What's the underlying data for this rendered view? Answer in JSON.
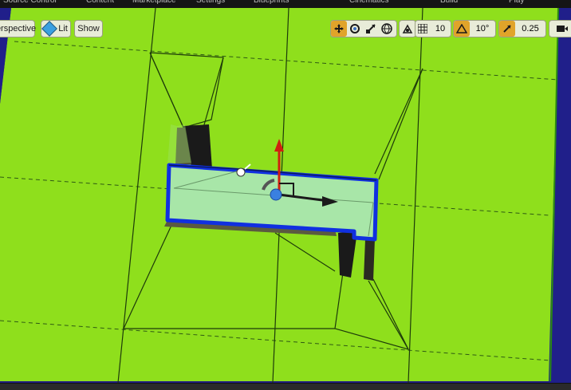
{
  "menu": {
    "tabs": [
      "Source Control",
      "Content",
      "Marketplace",
      "Settings",
      "Blueprints",
      "Cinematics",
      "Build",
      "Play",
      "Launch"
    ]
  },
  "viewport_toolbar": {
    "view_mode": "Perspective",
    "view_mode_visible_text": "erspective",
    "lighting": "Lit",
    "show": "Show",
    "grid_snap_value": "10",
    "rotation_snap_value": "10°",
    "scale_snap_value": "0.25"
  },
  "colors": {
    "floor": "#90e21a",
    "selection_outline": "#1030e0",
    "selected_fill": "#a6e6a6",
    "background": "#1f1e7e",
    "gizmo_x": "#1a1a1a",
    "gizmo_z": "#d02010",
    "toolbar_active": "#e0a42a"
  },
  "icons": [
    "lit-sphere-icon",
    "translate-icon",
    "rotate-icon",
    "scale-icon",
    "world-local-icon",
    "surface-snap-icon",
    "grid-icon",
    "angle-icon",
    "scale-snap-icon",
    "camera-speed-icon"
  ]
}
